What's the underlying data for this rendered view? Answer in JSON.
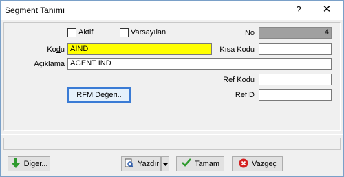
{
  "window": {
    "title": "Segment Tanımı",
    "help_glyph": "?",
    "close_glyph": "✕"
  },
  "form": {
    "aktif_label": "Aktif",
    "varsayilan_label": "Varsayılan",
    "no_label": "No",
    "no_value": "4",
    "kodu_label_pre": "Ko",
    "kodu_label_ul": "d",
    "kodu_label_post": "u",
    "kodu_value": "AIND",
    "kisa_kodu_label": "Kısa Kodu",
    "kisa_kodu_value": "",
    "aciklama_label_ul": "A",
    "aciklama_label_post": "çiklama",
    "aciklama_value": "AGENT IND",
    "ref_kodu_label": "Ref Kodu",
    "ref_kodu_value": "",
    "refid_label": "RefID",
    "refid_value": "",
    "rfm_button_label": "RFM Değeri.."
  },
  "footer": {
    "diger_ul": "D",
    "diger_post": "iger...",
    "yazdir_ul": "Y",
    "yazdir_post": "azdır",
    "tamam_ul": "T",
    "tamam_post": "amam",
    "vazgec_ul": "V",
    "vazgec_post": "azgeç"
  },
  "colors": {
    "code_field_bg": "#ffff00",
    "no_field_bg": "#a0a0a0"
  }
}
